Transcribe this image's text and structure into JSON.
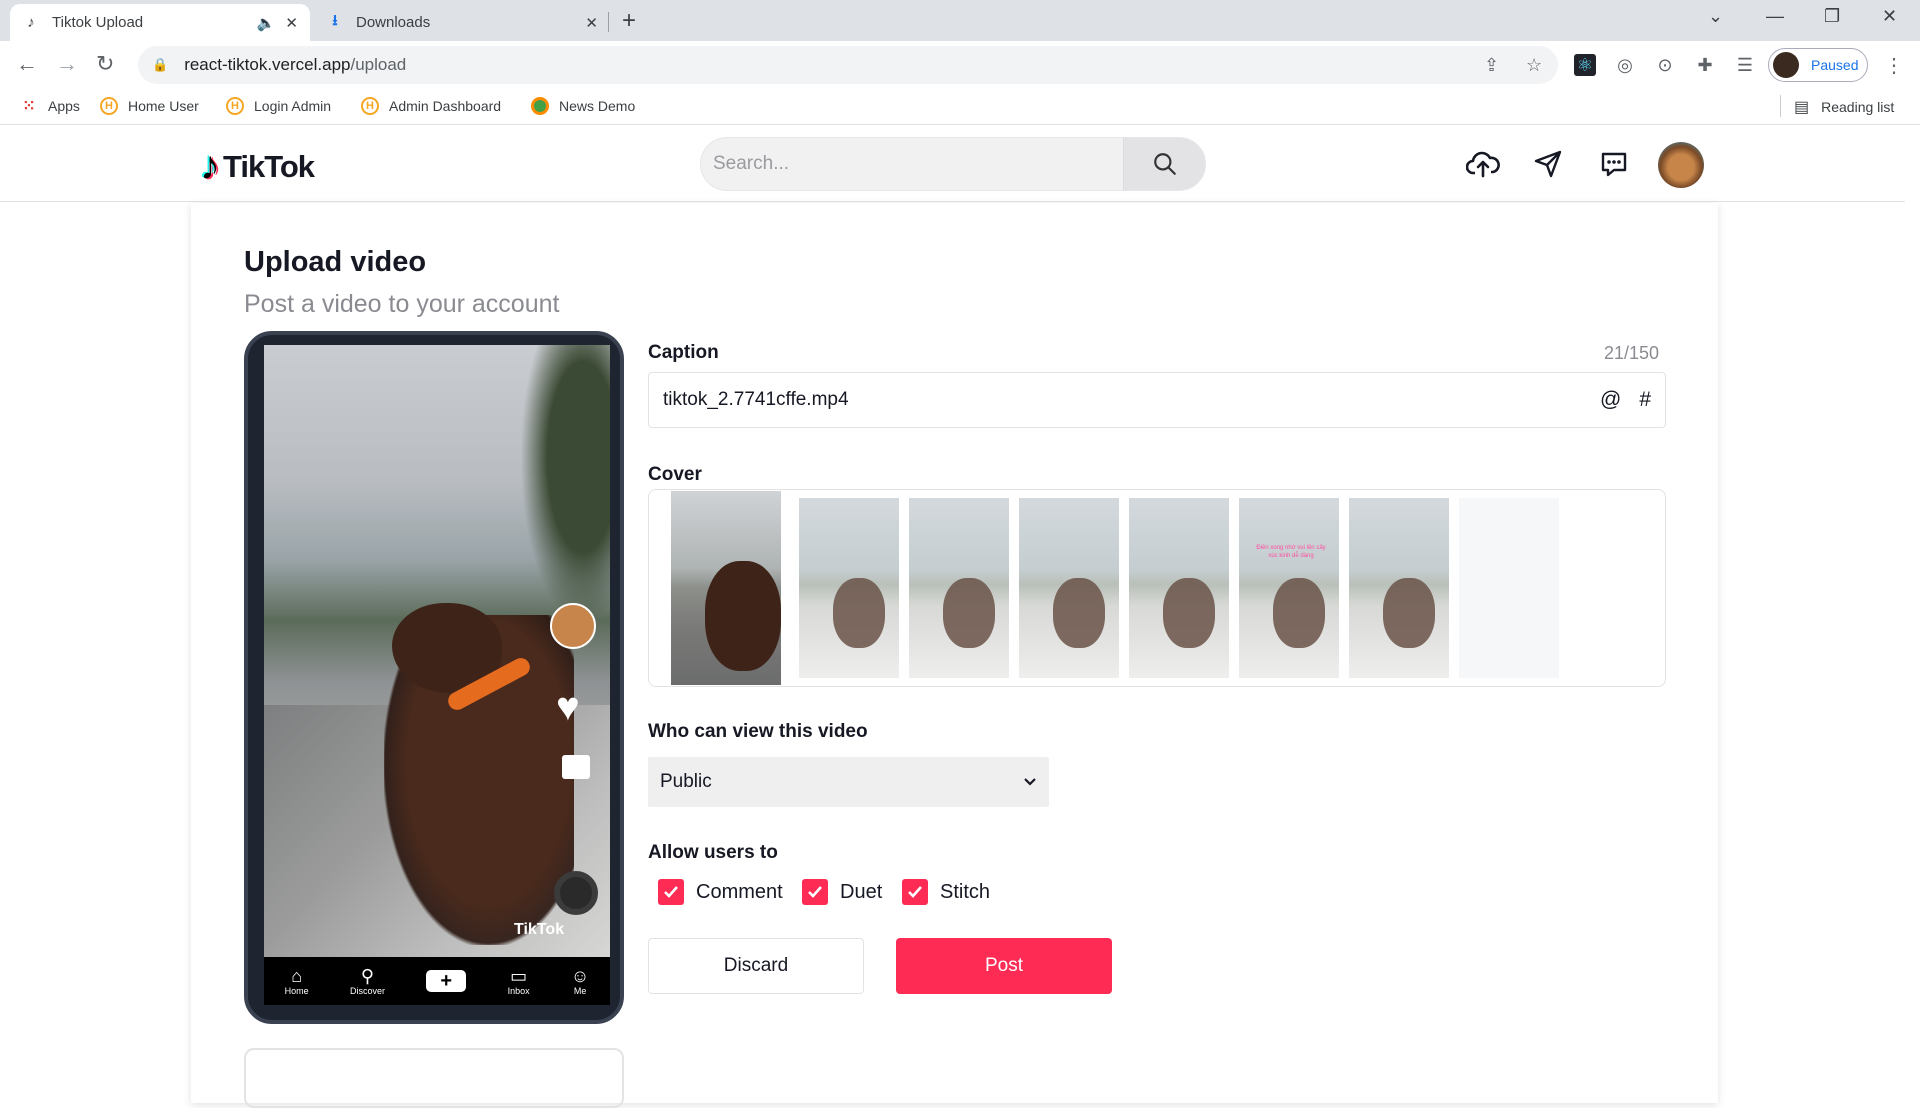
{
  "browser": {
    "tabs": [
      {
        "title": "Tiktok Upload",
        "active": true
      },
      {
        "title": "Downloads",
        "active": false
      }
    ],
    "url_host": "react-tiktok.vercel.app",
    "url_path": "/upload",
    "profile_status": "Paused",
    "bookmarks": [
      "Apps",
      "Home User",
      "Login Admin",
      "Admin Dashboard",
      "News Demo"
    ],
    "reading_list": "Reading list"
  },
  "header": {
    "logo_text": "TikTok",
    "search_placeholder": "Search..."
  },
  "page": {
    "title": "Upload video",
    "subtitle": "Post a video to your account"
  },
  "phone": {
    "watermark": "TikTok",
    "nav": [
      "Home",
      "Discover",
      "+",
      "Inbox",
      "Me"
    ]
  },
  "form": {
    "caption_label": "Caption",
    "caption_counter": "21/150",
    "caption_value": "tiktok_2.7741cffe.mp4",
    "mention_symbol": "@",
    "hashtag_symbol": "#",
    "cover_label": "Cover",
    "cover_overlay_text": "Điên xong nhớ vui lên cây xúc kinh dễ dàng",
    "privacy_label": "Who can view this video",
    "privacy_value": "Public",
    "allow_label": "Allow users to",
    "allow_options": [
      {
        "label": "Comment",
        "checked": true
      },
      {
        "label": "Duet",
        "checked": true
      },
      {
        "label": "Stitch",
        "checked": true
      }
    ],
    "discard_label": "Discard",
    "post_label": "Post"
  },
  "colors": {
    "accent": "#fe2c55",
    "text": "#161823",
    "muted": "#8a8b91"
  }
}
